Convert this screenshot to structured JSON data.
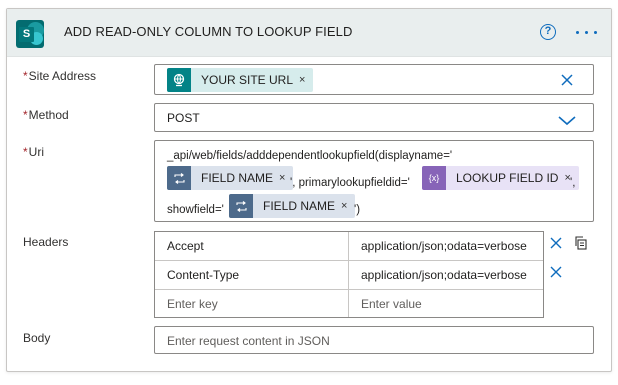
{
  "header": {
    "title": "ADD READ-ONLY COLUMN TO LOOKUP FIELD",
    "logo_letter": "S",
    "help_glyph": "?"
  },
  "site_address": {
    "label": "Site Address",
    "required": "*",
    "token": "YOUR SITE URL",
    "token_remove": "×",
    "clear_glyph": "✕"
  },
  "method": {
    "label": "Method",
    "required": "*",
    "value": "POST"
  },
  "uri": {
    "label": "Uri",
    "required": "*",
    "text1": "_api/web/fields/adddependentlookupfield(displayname='",
    "token1": "FIELD NAME",
    "text2": "', primarylookupfieldid='",
    "token2": "LOOKUP FIELD ID",
    "text3": "',",
    "text4": "showfield='",
    "token3": "FIELD NAME",
    "text5": "')",
    "token_remove": "×",
    "var_icon_glyph": "{x}"
  },
  "headers": {
    "label": "Headers",
    "rows": [
      {
        "key": "Accept",
        "value": "application/json;odata=verbose"
      },
      {
        "key": "Content-Type",
        "value": "application/json;odata=verbose"
      }
    ],
    "key_placeholder": "Enter key",
    "value_placeholder": "Enter value",
    "delete_glyph": "✕"
  },
  "body": {
    "label": "Body",
    "placeholder": "Enter request content in JSON"
  },
  "colors": {
    "accent": "#0f6cbd",
    "required": "#a4262c",
    "header_bg": "#e9eeee",
    "sharepoint": "#036c70",
    "token_site": "#d6ecec",
    "token_var": "#dbe2ec",
    "token_purple": "#e8e2f6"
  },
  "icons": {
    "logo": "sharepoint-logo",
    "help": "help-circle-icon",
    "more": "more-dots-icon",
    "site_token": "globe-icon",
    "var_token": "loop-icon",
    "expr_token": "expression-icon",
    "clear": "close-icon",
    "dropdown": "chevron-down-icon",
    "copy": "copy-icon"
  }
}
